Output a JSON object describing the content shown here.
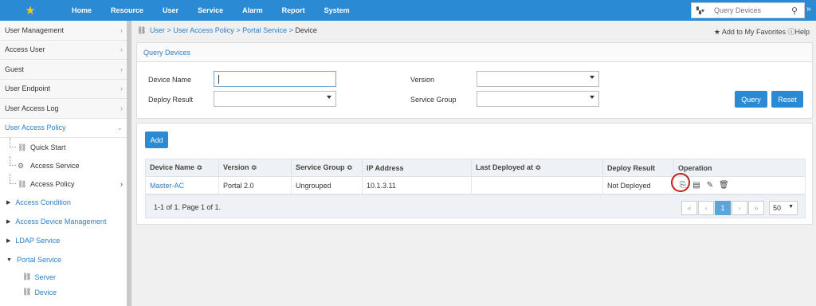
{
  "topnav": {
    "items": [
      "Home",
      "Resource",
      "User",
      "Service",
      "Alarm",
      "Report",
      "System"
    ],
    "search_placeholder": "Query Devices"
  },
  "sidebar": {
    "items": [
      {
        "label": "User Management"
      },
      {
        "label": "Access User"
      },
      {
        "label": "Guest"
      },
      {
        "label": "User Endpoint"
      },
      {
        "label": "User Access Log"
      },
      {
        "label": "User Access Policy"
      }
    ],
    "policy_children": [
      "Quick Start",
      "Access Service",
      "Access Policy"
    ],
    "sections": [
      "Access Condition",
      "Access Device Management",
      "LDAP Service",
      "Portal Service"
    ],
    "portal_children": [
      "Server",
      "Device"
    ]
  },
  "breadcrumb": {
    "parts": [
      "User",
      "User Access Policy",
      "Portal Service"
    ],
    "current": "Device",
    "sep": ">"
  },
  "favorites": {
    "label": "Add to My Favorites",
    "help": "Help"
  },
  "query": {
    "title": "Query Devices",
    "device_name_label": "Device Name",
    "version_label": "Version",
    "deploy_result_label": "Deploy Result",
    "service_group_label": "Service Group",
    "query_button": "Query",
    "reset_button": "Reset"
  },
  "list": {
    "add_button": "Add",
    "columns": [
      "Device Name ≎",
      "Version ≎",
      "Service Group ≎",
      "IP Address",
      "Last Deployed at ≎",
      "Deploy Result",
      "Operation"
    ],
    "rows": [
      {
        "device_name": "Master-AC",
        "version": "Portal 2.0",
        "service_group": "Ungrouped",
        "ip": "10.1.3.11",
        "last_deployed": "",
        "deploy_result": "Not Deployed"
      }
    ],
    "summary": "1-1 of 1. Page 1 of 1.",
    "page": "1",
    "page_size": "50"
  }
}
